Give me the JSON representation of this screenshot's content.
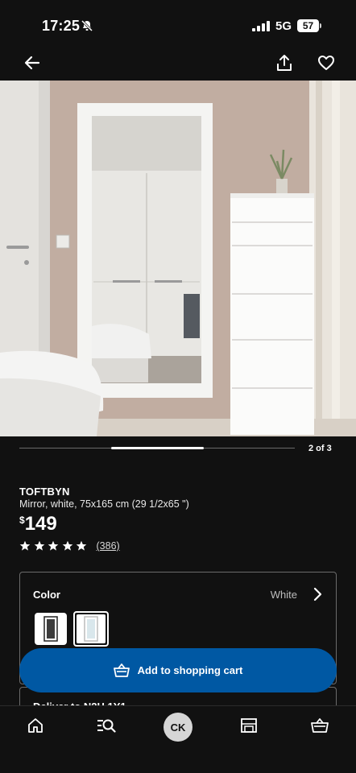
{
  "status_bar": {
    "time": "17:25",
    "network": "5G",
    "battery": "57"
  },
  "nav": {
    "back_icon": "arrow-left-icon",
    "share_icon": "share-icon",
    "favorite_icon": "heart-icon"
  },
  "gallery": {
    "counter": "2 of 3",
    "current_index": 2,
    "total": 3
  },
  "product": {
    "name": "TOFTBYN",
    "description": "Mirror, white, 75x165 cm (29 1/2x65 \")",
    "price_currency": "$",
    "price": "149",
    "rating": 5,
    "review_count": "(386)"
  },
  "color_selector": {
    "label": "Color",
    "value": "White",
    "options_count": 2,
    "selected_option": 2
  },
  "cart": {
    "label": "Add to shopping cart"
  },
  "delivery": {
    "label": "Deliver to N2H 1Y1"
  },
  "tab_bar": {
    "profile_initials": "CK"
  },
  "colors": {
    "accent_blue": "#0058a3",
    "background": "#111111",
    "text": "#ffffff"
  }
}
